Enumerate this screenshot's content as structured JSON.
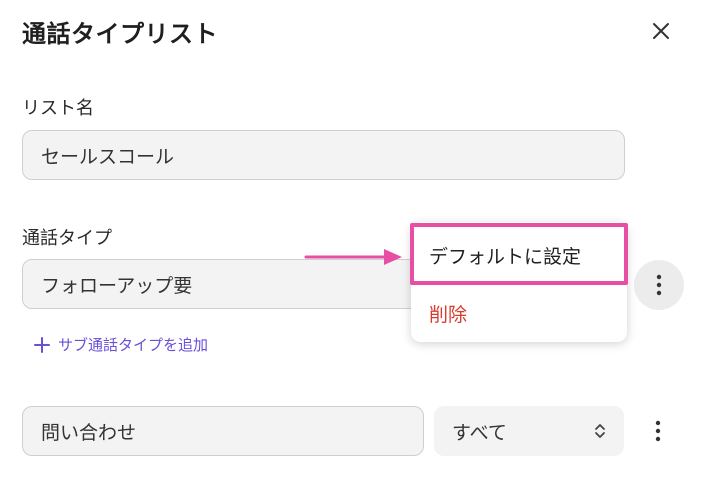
{
  "header": {
    "title": "通話タイプリスト"
  },
  "list_name": {
    "label": "リスト名",
    "value": "セールスコール"
  },
  "call_type": {
    "label": "通話タイプ",
    "value": "フォローアップ要"
  },
  "add_sub": {
    "label": "サブ通話タイプを追加"
  },
  "row2": {
    "value": "問い合わせ",
    "select_value": "すべて"
  },
  "context_menu": {
    "items": [
      {
        "label": "デフォルトに設定"
      },
      {
        "label": "削除"
      }
    ]
  },
  "colors": {
    "accent": "#6b4fd8",
    "danger": "#d63d2e",
    "highlight": "#e64fa3"
  }
}
